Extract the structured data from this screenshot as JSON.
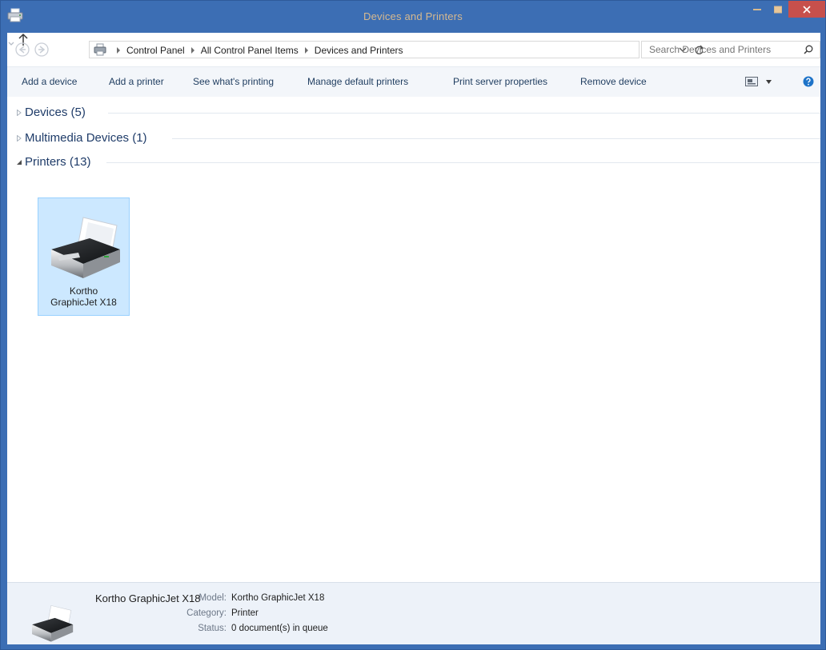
{
  "window": {
    "title": "Devices and Printers"
  },
  "address": {
    "crumbs": [
      "Control Panel",
      "All Control Panel Items",
      "Devices and Printers"
    ],
    "search_placeholder": "Search Devices and Printers"
  },
  "toolbar": {
    "add_device": "Add a device",
    "add_printer": "Add a printer",
    "see_printing": "See what's printing",
    "manage_defaults": "Manage default printers",
    "server_props": "Print server properties",
    "remove_device": "Remove device"
  },
  "groups": [
    {
      "label": "Devices (5)",
      "expanded": false
    },
    {
      "label": "Multimedia Devices (1)",
      "expanded": false
    },
    {
      "label": "Printers (13)",
      "expanded": true
    }
  ],
  "printer_tile": {
    "name_line1": "Kortho",
    "name_line2": "GraphicJet X18",
    "selected": true
  },
  "details": {
    "name": "Kortho GraphicJet X18",
    "model_label": "Model:",
    "model_value": "Kortho GraphicJet X18",
    "category_label": "Category:",
    "category_value": "Printer",
    "status_label": "Status:",
    "status_value": "0 document(s) in queue"
  },
  "colors": {
    "titlebar": "#3c6eb4",
    "selection": "#cce8ff",
    "close": "#c7504c",
    "link": "#1e3c5f"
  },
  "icons": [
    "printer-app-icon",
    "back-arrow-icon",
    "forward-arrow-icon",
    "up-arrow-icon",
    "refresh-icon",
    "search-icon",
    "view-icon",
    "help-icon",
    "printer-icon"
  ]
}
